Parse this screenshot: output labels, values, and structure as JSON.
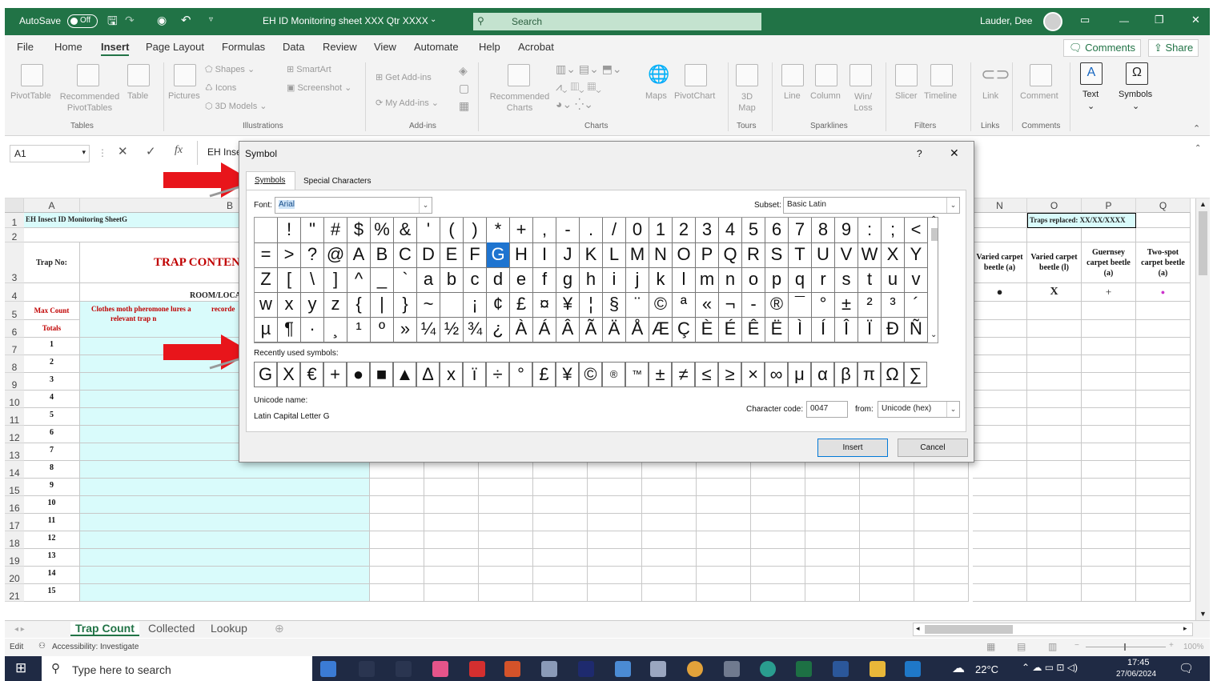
{
  "titlebar": {
    "autosave": "AutoSave",
    "toggle": "Off",
    "doc_title": "EH ID Monitoring sheet XXX Qtr XXXX",
    "search": "Search",
    "user": "Lauder, Dee"
  },
  "menu": {
    "items": [
      "File",
      "Home",
      "Insert",
      "Page Layout",
      "Formulas",
      "Data",
      "Review",
      "View",
      "Automate",
      "Help",
      "Acrobat"
    ],
    "active": "Insert",
    "comments": "Comments",
    "share": "Share"
  },
  "ribbon": {
    "tables": {
      "pivot": "PivotTable",
      "recommended": "Recommended PivotTables",
      "table": "Table",
      "group": "Tables"
    },
    "illustrations": {
      "pictures": "Pictures",
      "shapes": "Shapes",
      "icons": "Icons",
      "models": "3D Models",
      "smartart": "SmartArt",
      "screenshot": "Screenshot",
      "group": "Illustrations"
    },
    "addins": {
      "get": "Get Add-ins",
      "my": "My Add-ins",
      "group": "Add-ins"
    },
    "charts": {
      "recommended": "Recommended Charts",
      "maps": "Maps",
      "pivotchart": "PivotChart",
      "group": "Charts"
    },
    "tours": {
      "map3d": "3D Map",
      "group": "Tours"
    },
    "sparklines": {
      "line": "Line",
      "column": "Column",
      "winloss": "Win/ Loss",
      "group": "Sparklines"
    },
    "filters": {
      "slicer": "Slicer",
      "timeline": "Timeline",
      "group": "Filters"
    },
    "links": {
      "link": "Link",
      "group": "Links"
    },
    "comments": {
      "comment": "Comment",
      "group": "Comments"
    },
    "text": "Text",
    "symbols": "Symbols"
  },
  "formula": {
    "namebox": "A1",
    "fx": "fx",
    "content": "EH Inse"
  },
  "sheet": {
    "columns": [
      "A",
      "B",
      "N",
      "O",
      "P",
      "Q"
    ],
    "rows": [
      "1",
      "2",
      "3",
      "4",
      "5",
      "6",
      "7",
      "8",
      "9",
      "10",
      "11",
      "12",
      "13",
      "14",
      "15",
      "16",
      "17",
      "18",
      "19",
      "20",
      "21"
    ],
    "a1": "EH Insect ID Monitoring SheetG",
    "trap_no": "Trap No:",
    "trap_contents": "TRAP CONTEN",
    "room_loc": "ROOM/LOCA",
    "max_count": "Max Count",
    "clothes_moth": "Clothes moth pheromone lures a",
    "relevant_trap": "relevant trap n",
    "recorde": "recorde",
    "totals": "Totals",
    "trap_numbers": [
      "1",
      "2",
      "3",
      "4",
      "5",
      "6",
      "7",
      "8",
      "9",
      "10",
      "11",
      "12",
      "13",
      "14",
      "15"
    ],
    "traps_replaced": "Traps replaced: XX/XX/XXXX",
    "n_header": "Varied carpet beetle (a)",
    "o_header": "Varied carpet beetle (l)",
    "p_header": "Guernsey carpet beetle (a)",
    "q_header": "Two-spot carpet beetle (a)",
    "n_sym": "●",
    "o_sym": "X",
    "p_sym": "+",
    "q_sym": "●",
    "magenta": "#cc33cc"
  },
  "dialog": {
    "title": "Symbol",
    "help": "?",
    "close": "✕",
    "tab_symbols": "Symbols",
    "tab_special": "Special Characters",
    "font_label": "Font:",
    "font_value": "Arial",
    "subset_label": "Subset:",
    "subset_value": "Basic Latin",
    "grid": [
      [
        "",
        "!",
        "\"",
        "#",
        "$",
        "%",
        "&",
        "'",
        "(",
        ")",
        "*",
        "+",
        ",",
        "-",
        ".",
        "/",
        "0",
        "1",
        "2",
        "3",
        "4",
        "5",
        "6",
        "7",
        "8",
        "9",
        ":",
        ";",
        "<"
      ],
      [
        "=",
        ">",
        "?",
        "@",
        "A",
        "B",
        "C",
        "D",
        "E",
        "F",
        "G",
        "H",
        "I",
        "J",
        "K",
        "L",
        "M",
        "N",
        "O",
        "P",
        "Q",
        "R",
        "S",
        "T",
        "U",
        "V",
        "W",
        "X",
        "Y"
      ],
      [
        "Z",
        "[",
        "\\",
        "]",
        "^",
        "_",
        "`",
        "a",
        "b",
        "c",
        "d",
        "e",
        "f",
        "g",
        "h",
        "i",
        "j",
        "k",
        "l",
        "m",
        "n",
        "o",
        "p",
        "q",
        "r",
        "s",
        "t",
        "u",
        "v"
      ],
      [
        "w",
        "x",
        "y",
        "z",
        "{",
        "|",
        "}",
        "~",
        "",
        "¡",
        "¢",
        "£",
        "¤",
        "¥",
        "¦",
        "§",
        "¨",
        "©",
        "ª",
        "«",
        "¬",
        "-",
        "®",
        "¯",
        "°",
        "±",
        "²",
        "³",
        "´"
      ],
      [
        "µ",
        "¶",
        "·",
        "¸",
        "¹",
        "º",
        "»",
        "¼",
        "½",
        "¾",
        "¿",
        "À",
        "Á",
        "Â",
        "Ã",
        "Ä",
        "Å",
        "Æ",
        "Ç",
        "È",
        "É",
        "Ê",
        "Ë",
        "Ì",
        "Í",
        "Î",
        "Ï",
        "Ð",
        "Ñ"
      ]
    ],
    "selected_symbol": "G",
    "recent_label": "Recently used symbols:",
    "recent": [
      "G",
      "X",
      "€",
      "+",
      "●",
      "■",
      "▲",
      "Δ",
      "x",
      "ï",
      "÷",
      "°",
      "£",
      "¥",
      "©",
      "®",
      "™",
      "±",
      "≠",
      "≤",
      "≥",
      "×",
      "∞",
      "μ",
      "α",
      "β",
      "π",
      "Ω",
      "∑"
    ],
    "unicode_name_label": "Unicode name:",
    "unicode_name": "Latin Capital Letter G",
    "charcode_label": "Character code:",
    "charcode": "0047",
    "from_label": "from:",
    "from_value": "Unicode (hex)",
    "insert": "Insert",
    "cancel": "Cancel"
  },
  "tabs": {
    "items": [
      "Trap Count",
      "Collected",
      "Lookup"
    ],
    "active": "Trap Count"
  },
  "status": {
    "mode": "Edit",
    "accessibility": "Accessibility: Investigate",
    "zoom": "100%"
  },
  "taskbar": {
    "search": "Type here to search",
    "temp": "22°C",
    "time": "17:45",
    "date": "27/06/2024"
  },
  "colors": {
    "excel_green": "#217346",
    "cyan": "#d9fbfb",
    "red_arrow": "#e8151b",
    "selected": "#1e74d0"
  }
}
